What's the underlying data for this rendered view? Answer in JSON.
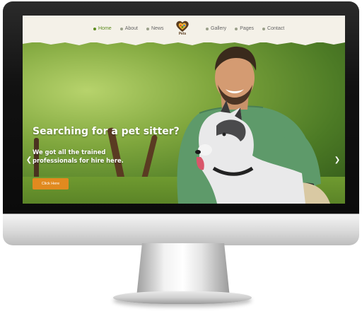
{
  "nav": {
    "left_items": [
      {
        "label": "Home",
        "active": true
      },
      {
        "label": "About",
        "active": false
      },
      {
        "label": "News",
        "active": false
      }
    ],
    "right_items": [
      {
        "label": "Gallery",
        "active": false
      },
      {
        "label": "Pages",
        "active": false
      },
      {
        "label": "Contact",
        "active": false
      }
    ],
    "logo_text": "Pets"
  },
  "hero": {
    "headline": "Searching for a pet sitter?",
    "subline": "We got all the trained professionals for hire here.",
    "cta_label": "Click Here",
    "prev_icon": "chevron-left-icon",
    "next_icon": "chevron-right-icon"
  },
  "colors": {
    "accent_green": "#5d8c1f",
    "cta_orange": "#e18a1f",
    "nav_bg": "#f4f1e8"
  }
}
